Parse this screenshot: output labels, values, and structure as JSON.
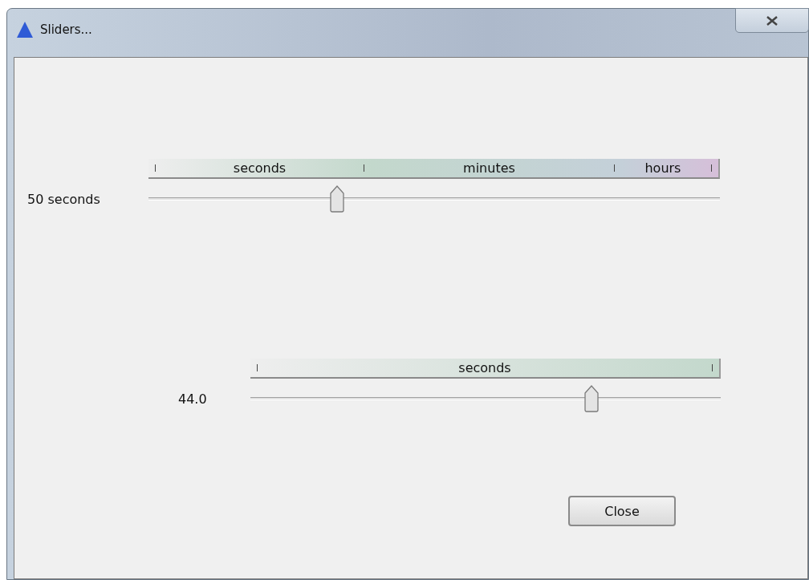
{
  "window": {
    "title": "Sliders..."
  },
  "sliders": [
    {
      "reading": "50 seconds",
      "level": 0.33,
      "scale": [
        {
          "label": "seconds",
          "color": "#c3d8cc"
        },
        {
          "label": "minutes",
          "color": "#c4d0d9"
        },
        {
          "label": "hours",
          "color": "#d6bfd9"
        }
      ]
    },
    {
      "reading": "44.0",
      "level": 0.725,
      "scale": [
        {
          "label": "seconds",
          "color": "#c3d8cc"
        }
      ]
    }
  ],
  "buttons": [
    "Close"
  ]
}
